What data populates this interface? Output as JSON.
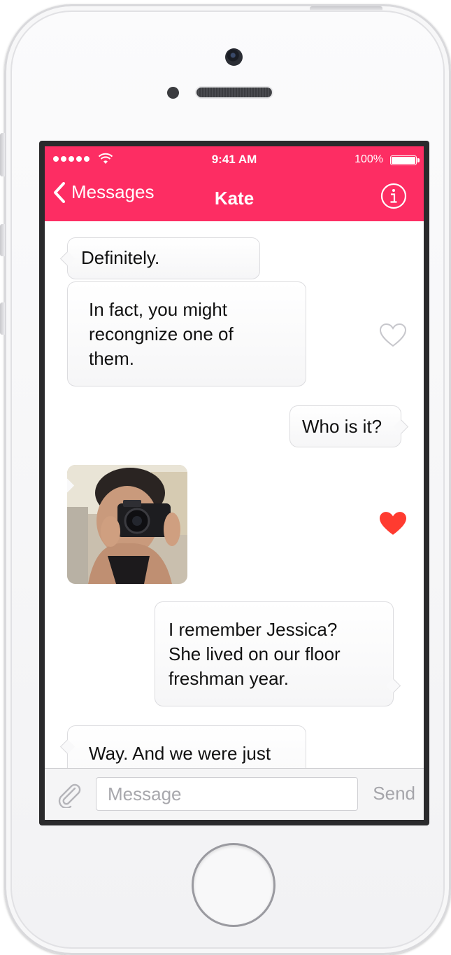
{
  "status_bar": {
    "time": "9:41 AM",
    "battery": "100%"
  },
  "nav": {
    "back_label": "Messages",
    "title": "Kate"
  },
  "messages": [
    {
      "side": "incoming",
      "text": "Definitely."
    },
    {
      "side": "incoming",
      "text": "In fact, you might\nrecongnize one of\nthem.",
      "liked": false
    },
    {
      "side": "outgoing",
      "text": "Who is it?"
    },
    {
      "side": "incoming",
      "type": "photo",
      "liked": true
    },
    {
      "side": "outgoing",
      "text": "I remember Jessica?\nShe lived on our floor\nfreshman year."
    },
    {
      "side": "incoming",
      "text": "Way. And we were just"
    }
  ],
  "composer": {
    "placeholder": "Message",
    "send_label": "Send"
  },
  "colors": {
    "accent": "#fd2d63",
    "like_active": "#ff3b30",
    "like_inactive": "#c7c7cc"
  }
}
